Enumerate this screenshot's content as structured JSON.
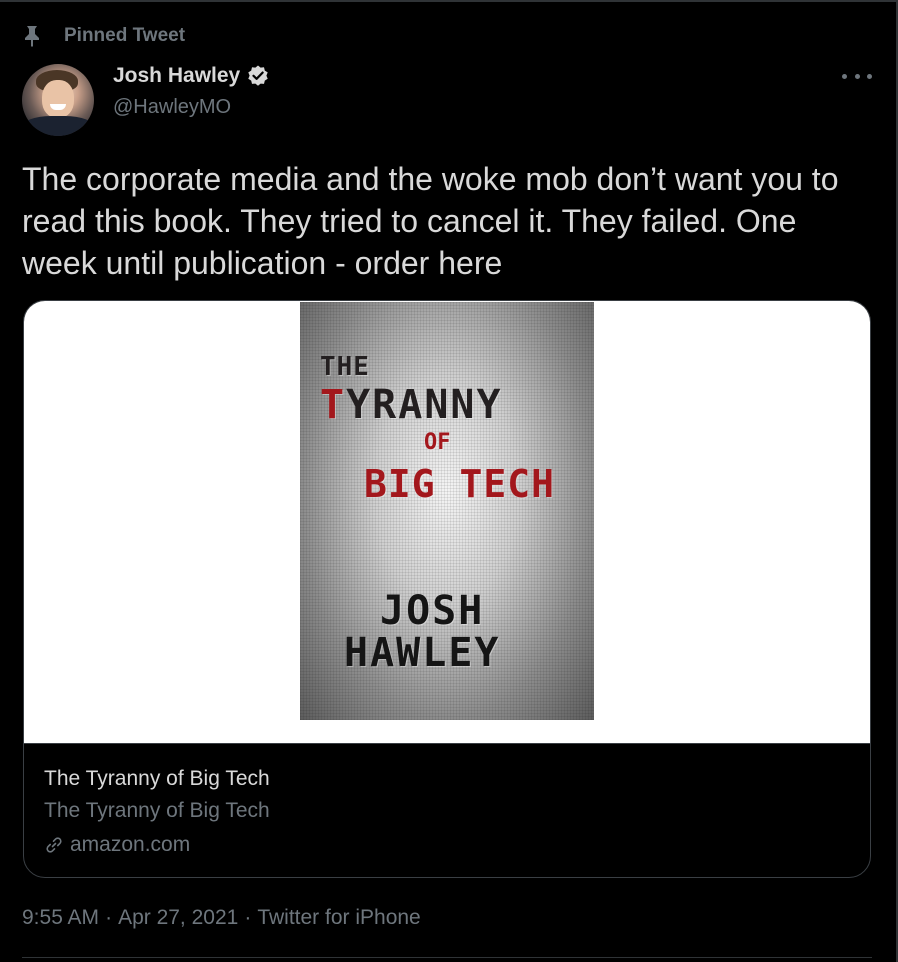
{
  "pinned": {
    "label": "Pinned Tweet",
    "icon": "pin-icon"
  },
  "author": {
    "name": "Josh Hawley",
    "handle": "@HawleyMO",
    "verified": true,
    "avatar_icon": "avatar-photo"
  },
  "tweet": {
    "text": "The corporate media and the woke mob don’t want you to read this book. They tried to cancel it. They failed. One week until publication - order here"
  },
  "card": {
    "cover": {
      "line1": "THE",
      "line2_red": "T",
      "line2_rest": "YRANNY",
      "line3": "OF",
      "line4": "BIG TECH",
      "author_line1": "JOSH",
      "author_line2": "HAWLEY"
    },
    "title": "The Tyranny of Big Tech",
    "description": "The Tyranny of Big Tech",
    "domain": "amazon.com",
    "link_icon": "link-icon"
  },
  "meta": {
    "time": "9:55 AM",
    "date": "Apr 27, 2021",
    "source": "Twitter for iPhone",
    "separator": "·"
  },
  "colors": {
    "background": "#000000",
    "text": "#d9d9d9",
    "muted": "#6e767d",
    "border": "#2f3336",
    "cover_red": "#a3171c"
  }
}
